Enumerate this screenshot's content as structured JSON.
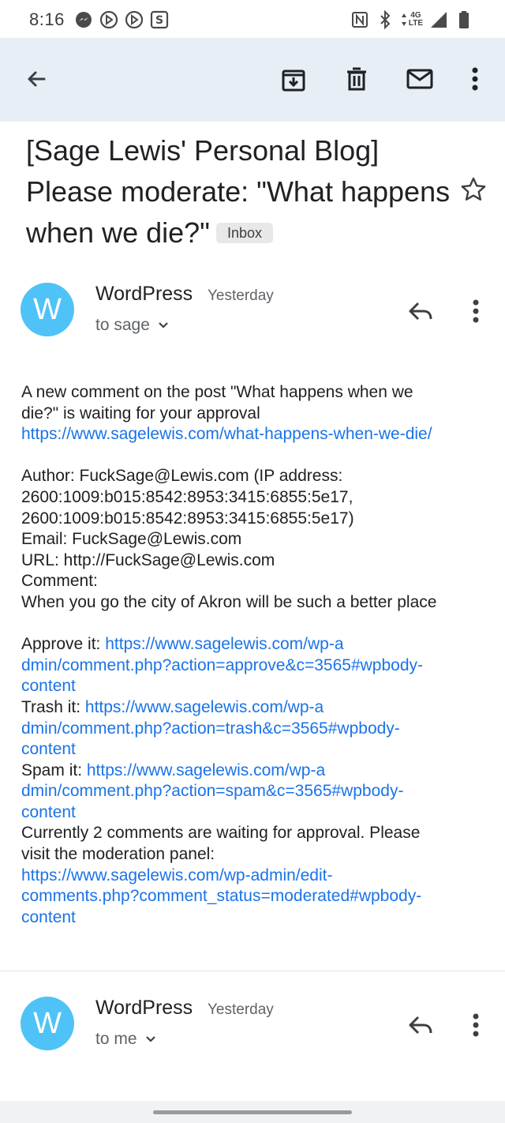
{
  "status_bar": {
    "time": "8:16",
    "left_icons": [
      "messenger-icon",
      "media-play-icon",
      "media-play-icon",
      "app-s-icon"
    ],
    "right_icons": [
      "nfc-icon",
      "bluetooth-icon",
      "network-4g-lte-icon",
      "signal-icon",
      "battery-icon"
    ],
    "network_label_top": "4G",
    "network_label_bottom": "LTE"
  },
  "toolbar": {
    "icons": [
      "back-arrow-icon",
      "archive-icon",
      "delete-icon",
      "mark-unread-icon",
      "more-vert-icon"
    ]
  },
  "subject": {
    "text": "[Sage Lewis' Personal Blog] Please moderate: \"What happens when we die?\"",
    "label": "Inbox"
  },
  "messages": [
    {
      "avatar_letter": "W",
      "sender": "WordPress",
      "date": "Yesterday",
      "recipient": "to sage"
    },
    {
      "avatar_letter": "W",
      "sender": "WordPress",
      "date": "Yesterday",
      "recipient": "to me"
    }
  ],
  "body": {
    "intro_line1": "A new comment on the post \"What happens when we",
    "intro_line2": "die?\" is waiting for your approval",
    "post_link": "https://www.sagelewis.com/what-happens-when-we-die/",
    "author_line1": "Author: FuckSage@Lewis.com (IP address:",
    "author_line2": "2600:1009:b015:8542:8953:3415:6855:5e17,",
    "author_line3": "2600:1009:b015:8542:8953:3415:6855:5e17)",
    "email": "Email: FuckSage@Lewis.com",
    "url": "URL: http://FuckSage@Lewis.com",
    "comment_label": "Comment:",
    "comment_text": "When you go the city of Akron will be such a better place",
    "approve_label": "Approve it: ",
    "approve_link1": "https://www.sagelewis.com/wp-a",
    "approve_link2": "dmin/comment.php?action=approve&c=3565#wpbody-",
    "approve_link3": "content",
    "trash_label": "Trash it: ",
    "trash_link1": "https://www.sagelewis.com/wp-a",
    "trash_link2": "dmin/comment.php?action=trash&c=3565#wpbody-",
    "trash_link3": "content",
    "spam_label": "Spam it: ",
    "spam_link1": "https://www.sagelewis.com/wp-a",
    "spam_link2": "dmin/comment.php?action=spam&c=3565#wpbody-",
    "spam_link3": "content",
    "pending_line1": "Currently 2 comments are waiting for approval. Please",
    "pending_line2": "visit the moderation panel:",
    "moderation_link1": "https://www.sagelewis.com/wp-admin/edit-",
    "moderation_link2": "comments.php?comment_status=moderated#wpbody-",
    "moderation_link3": "content"
  },
  "colors": {
    "toolbar_bg": "#e8eef5",
    "avatar": "#4fc3f7",
    "link": "#1a73e8"
  }
}
